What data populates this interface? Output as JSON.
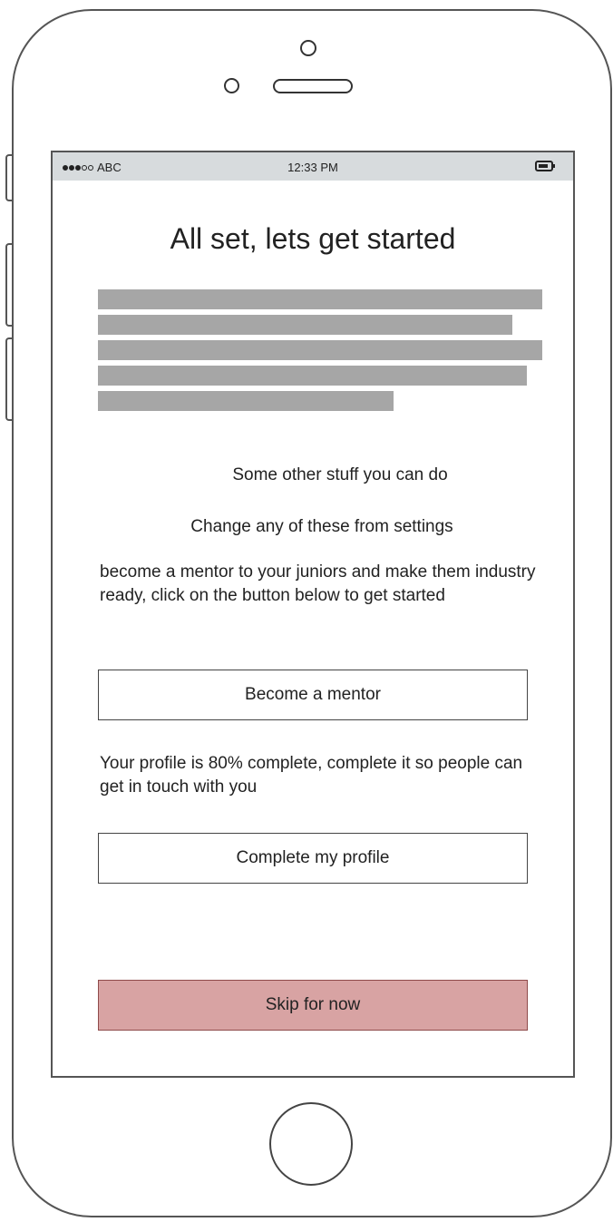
{
  "status_bar": {
    "carrier": "ABC",
    "time": "12:33 PM",
    "signal_filled": 3,
    "signal_total": 5
  },
  "screen": {
    "title": "All set, lets get started",
    "other_stuff_heading": "Some other stuff you can do",
    "settings_note": "Change any of these from settings",
    "mentor_text": "become a mentor to your juniors and make them industry ready, click on the button below to get started",
    "mentor_button": "Become a mentor",
    "profile_text": "Your profile is 80% complete, complete it so people can get in touch with you",
    "profile_button": "Complete my profile",
    "skip_button": "Skip for now"
  },
  "colors": {
    "status_bar_bg": "#d7dbdd",
    "placeholder_text_block": "#a6a6a6",
    "skip_button_bg": "#d8a3a3"
  }
}
